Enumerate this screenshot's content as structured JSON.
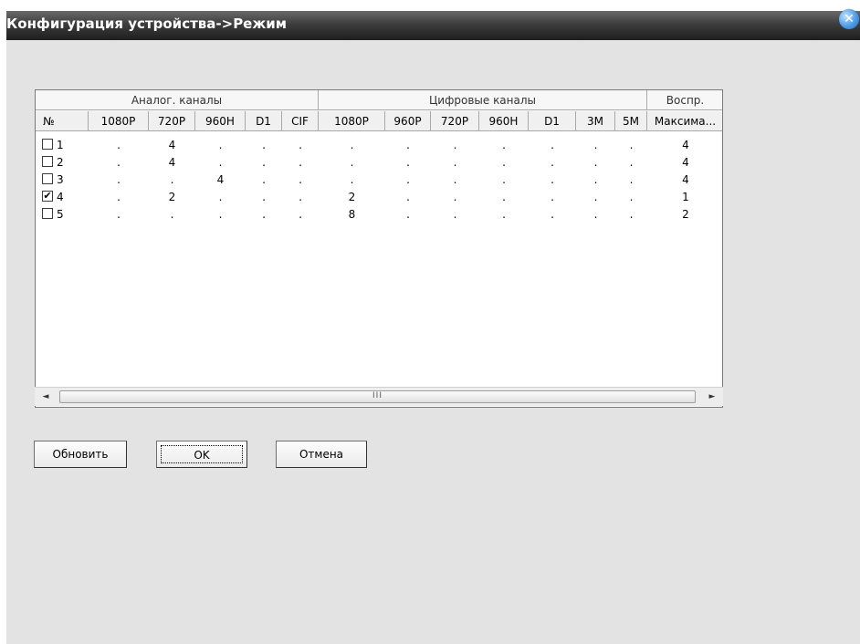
{
  "window": {
    "title": "Конфигурация устройства->Режим",
    "close_symbol": "✕"
  },
  "table": {
    "groups": [
      {
        "label": ""
      },
      {
        "label": "Аналог. каналы"
      },
      {
        "label": "Цифровые каналы"
      },
      {
        "label": "Воспр."
      }
    ],
    "columns": [
      "№",
      "1080P",
      "720P",
      "960H",
      "D1",
      "CIF",
      "1080P",
      "960P",
      "720P",
      "960H",
      "D1",
      "3M",
      "5M",
      "Максима..."
    ],
    "rows": [
      {
        "no": "1",
        "checked": false,
        "cells": [
          ".",
          "4",
          ".",
          ".",
          ".",
          ".",
          ".",
          ".",
          ".",
          ".",
          ".",
          ".",
          "4"
        ]
      },
      {
        "no": "2",
        "checked": false,
        "cells": [
          ".",
          "4",
          ".",
          ".",
          ".",
          ".",
          ".",
          ".",
          ".",
          ".",
          ".",
          ".",
          "4"
        ]
      },
      {
        "no": "3",
        "checked": false,
        "cells": [
          ".",
          ".",
          "4",
          ".",
          ".",
          ".",
          ".",
          ".",
          ".",
          ".",
          ".",
          ".",
          "4"
        ]
      },
      {
        "no": "4",
        "checked": true,
        "cells": [
          ".",
          "2",
          ".",
          ".",
          ".",
          "2",
          ".",
          ".",
          ".",
          ".",
          ".",
          ".",
          "1"
        ]
      },
      {
        "no": "5",
        "checked": false,
        "cells": [
          ".",
          ".",
          ".",
          ".",
          ".",
          "8",
          ".",
          ".",
          ".",
          ".",
          ".",
          ".",
          "2"
        ]
      }
    ],
    "check_mark": "✔",
    "scroll": {
      "left_arrow": "◄",
      "right_arrow": "►",
      "thumb_grip": "III"
    }
  },
  "buttons": {
    "refresh": "Обновить",
    "ok": "OK",
    "cancel": "Отмена"
  }
}
